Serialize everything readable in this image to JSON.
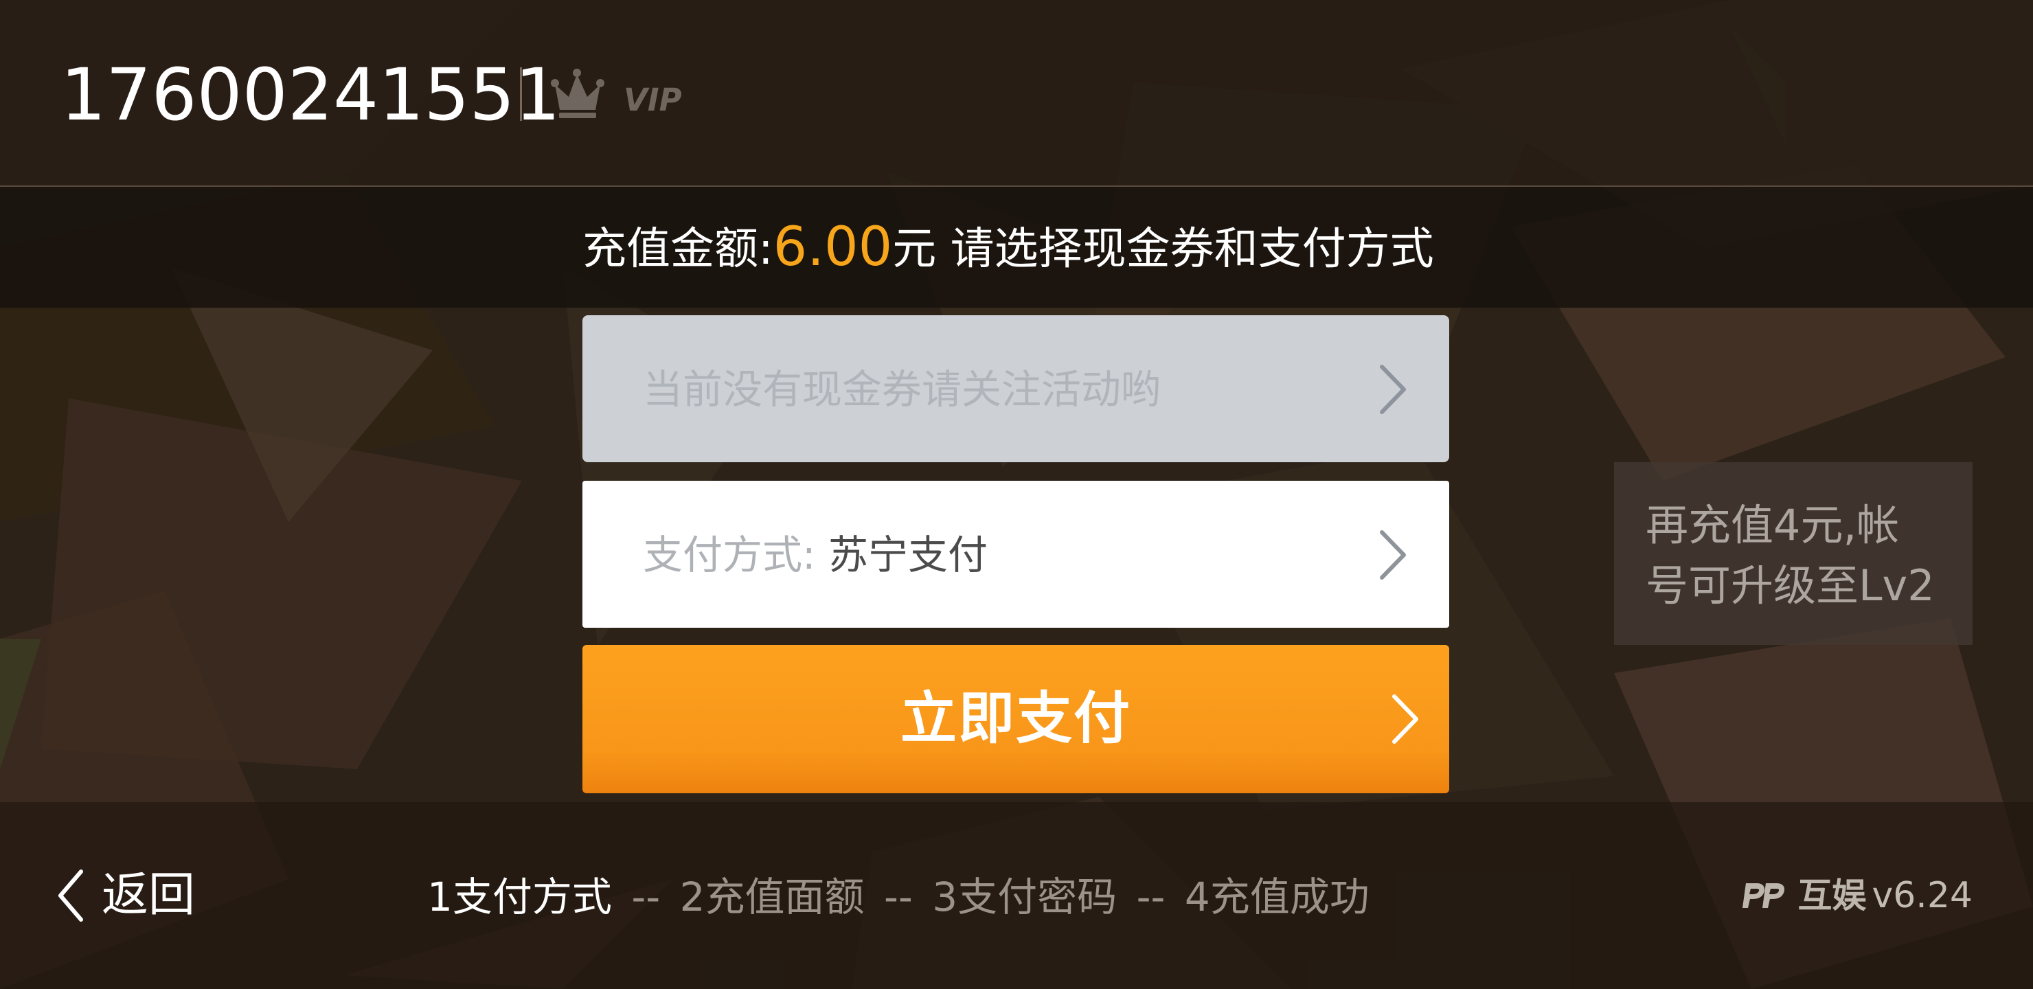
{
  "header": {
    "account_id": "17600241551",
    "vip_label": "VIP"
  },
  "recharge": {
    "amount_prefix": "充值金额:",
    "amount_value": "6.00",
    "amount_suffix": "元 请选择现金券和支付方式"
  },
  "coupon": {
    "text": "当前没有现金券请关注活动哟"
  },
  "payment": {
    "label": "支付方式: ",
    "value": "苏宁支付"
  },
  "actions": {
    "pay_now": "立即支付"
  },
  "tip": {
    "text": "再充值4元,帐\n号可升级至Lv2"
  },
  "footer": {
    "back_label": "返回",
    "steps": [
      "1支付方式",
      "2充值面额",
      "3支付密码",
      "4充值成功"
    ],
    "separator": "--",
    "brand_name": "互娱",
    "version": "v6.24"
  },
  "colors": {
    "accent": "#f7a51a",
    "button": "#f89619",
    "coupon_card": "#cdd1d6",
    "background": "#2c2218"
  },
  "icons": {
    "crown": "crown-icon",
    "chevron": "chevron-right-icon",
    "back": "chevron-left-icon",
    "brand": "pp-logo-icon"
  }
}
